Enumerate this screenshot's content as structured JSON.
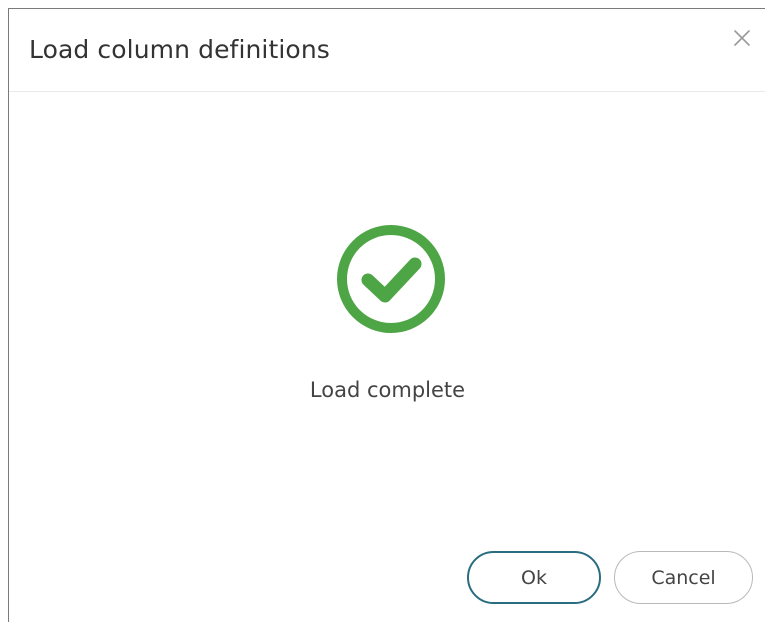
{
  "dialog": {
    "title": "Load column definitions",
    "close_icon": "close-icon",
    "status_icon": "check-circle-icon",
    "status_color": "#4ea546",
    "message": "Load complete",
    "buttons": {
      "ok_label": "Ok",
      "cancel_label": "Cancel"
    },
    "ok_border_color": "#2b6c80"
  }
}
